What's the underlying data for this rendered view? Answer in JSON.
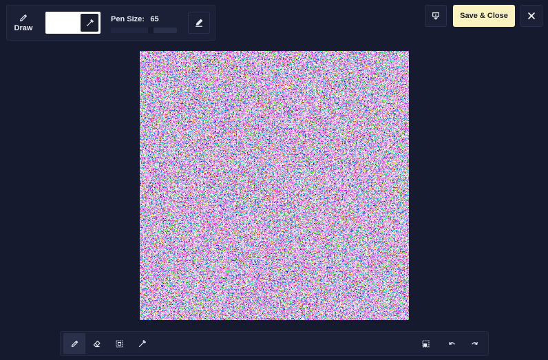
{
  "toolbar": {
    "draw_label": "Draw",
    "draw_icon": "pencil-icon",
    "color_value": "#ffffff",
    "picker_icon": "eyedropper-icon",
    "pen_size_label": "Pen Size:",
    "pen_size_value": "65",
    "pen_size_fraction": 0.6,
    "brush_settings_icon": "brush-icon"
  },
  "actions": {
    "download_icon": "download-icon",
    "save_label": "Save & Close",
    "close_icon": "close-icon"
  },
  "bottom_tools": {
    "draw": {
      "icon": "pencil-icon",
      "active": true
    },
    "eraser": {
      "icon": "eraser-icon"
    },
    "select": {
      "icon": "selection-icon"
    },
    "eyedropper": {
      "icon": "eyedropper-icon"
    },
    "fit": {
      "icon": "fit-screen-icon"
    },
    "undo": {
      "icon": "undo-icon"
    },
    "redo": {
      "icon": "redo-icon"
    }
  },
  "colors": {
    "background": "#161a2e",
    "panel": "#1c2036",
    "accent": "#faf3c0"
  }
}
